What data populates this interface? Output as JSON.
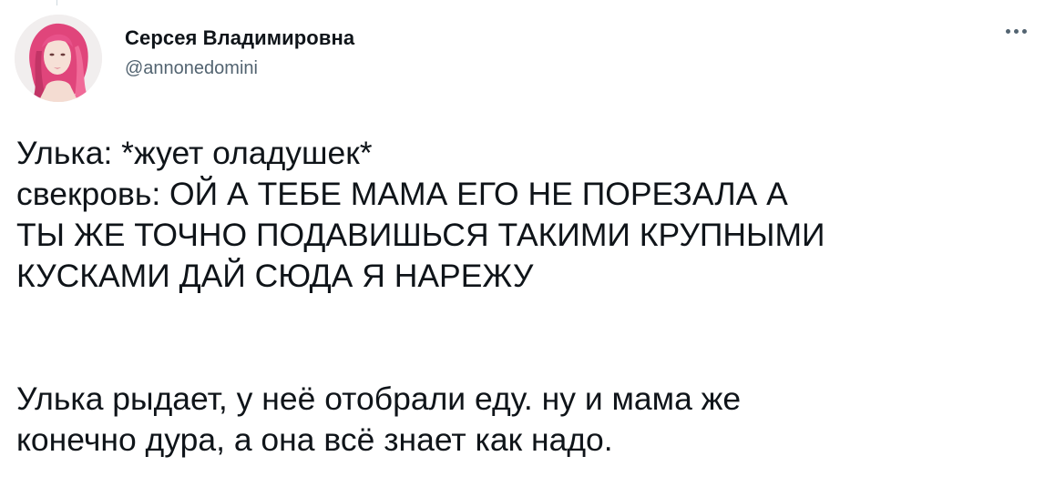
{
  "tweet": {
    "author_name": "Серсея Владимировна",
    "author_handle": "@annonedomini",
    "lines": [
      "Улька: *жует оладушек*",
      "свекровь: ОЙ А ТЕБЕ МАМА ЕГО НЕ ПОРЕЗАЛА А",
      "ТЫ ЖЕ ТОЧНО ПОДАВИШЬСЯ ТАКИМИ КРУПНЫМИ",
      "КУСКАМИ ДАЙ СЮДА Я НАРЕЖУ",
      "Улька рыдает, у неё отобрали еду. ну и мама же",
      "конечно дура, а она всё знает как надо."
    ]
  },
  "icons": {
    "more": "more-horizontal-icon",
    "avatar": "profile-avatar"
  },
  "colors": {
    "text_primary": "#0f1419",
    "text_secondary": "#536471",
    "background": "#ffffff",
    "avatar_hair": "#e0457b"
  }
}
